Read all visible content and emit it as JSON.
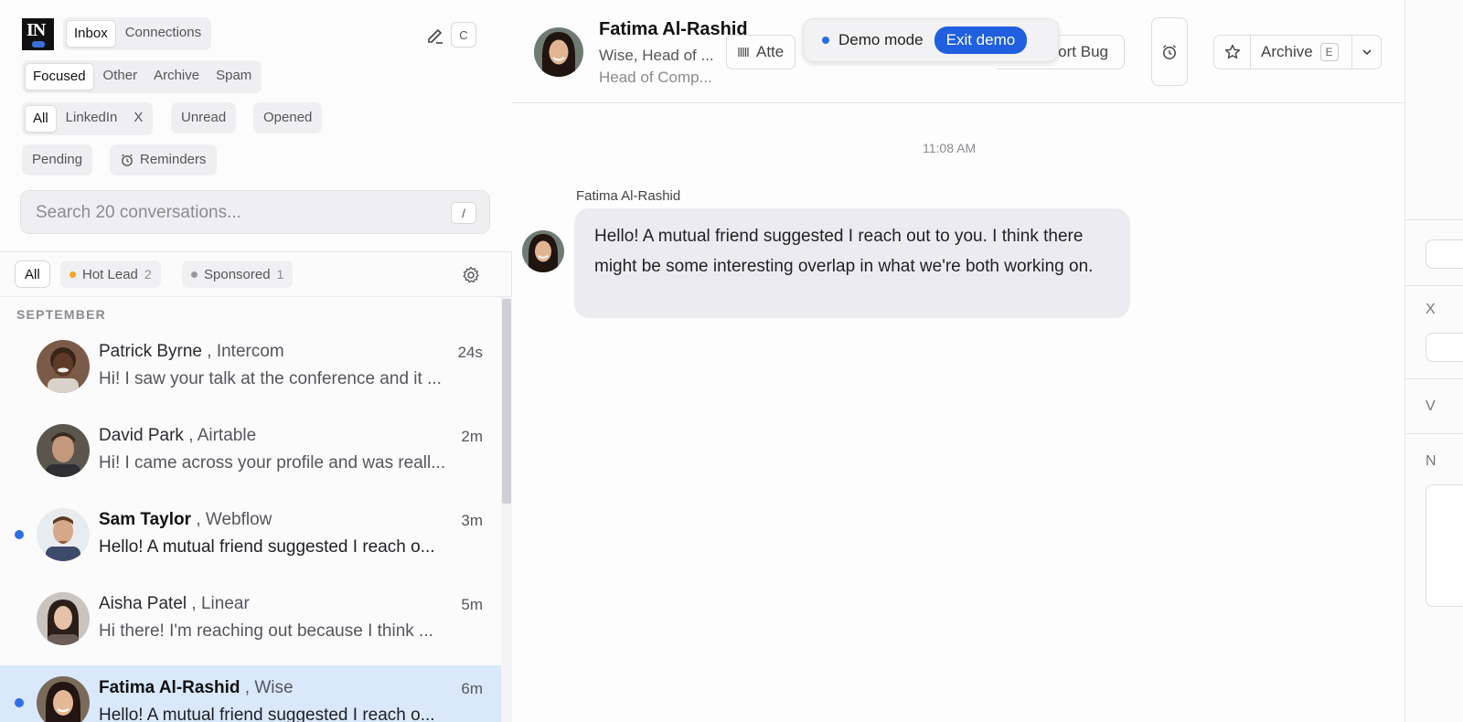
{
  "sidebar": {
    "logo_text": "IN",
    "top_tabs": [
      "Inbox",
      "Connections"
    ],
    "compose_key": "C",
    "folder_tabs": [
      "Focused",
      "Other",
      "Archive",
      "Spam"
    ],
    "channel_tabs": [
      "All",
      "LinkedIn",
      "X"
    ],
    "filter_unread": "Unread",
    "filter_opened": "Opened",
    "filter_pending": "Pending",
    "filter_reminders": "Reminders",
    "search_placeholder": "Search 20 conversations...",
    "search_shortcut": "/",
    "tags": {
      "all": "All",
      "hot_lead": "Hot Lead",
      "hot_lead_count": "2",
      "sponsored": "Sponsored",
      "sponsored_count": "1"
    },
    "tag_colors": {
      "hot_lead": "#f5a524",
      "sponsored": "#9a9aa2"
    },
    "section_label": "SEPTEMBER",
    "conversations": [
      {
        "name": "Patrick Byrne",
        "company": ", Intercom",
        "time": "24s",
        "preview": "Hi! I saw your talk at the conference and it ...",
        "unread": false,
        "selected": false
      },
      {
        "name": "David Park",
        "company": ", Airtable",
        "time": "2m",
        "preview": "Hi! I came across your profile and was reall...",
        "unread": false,
        "selected": false
      },
      {
        "name": "Sam Taylor",
        "company": ", Webflow",
        "time": "3m",
        "preview": "Hello! A mutual friend suggested I reach o...",
        "unread": true,
        "selected": false
      },
      {
        "name": "Aisha Patel",
        "company": ", Linear",
        "time": "5m",
        "preview": "Hi there! I'm reaching out because I think ...",
        "unread": false,
        "selected": false
      },
      {
        "name": "Fatima Al-Rashid",
        "company": ", Wise",
        "time": "6m",
        "preview": "Hello! A mutual friend suggested I reach o...",
        "unread": true,
        "selected": true
      }
    ]
  },
  "header": {
    "name": "Fatima Al-Rashid",
    "subtitle1": "Wise, Head of ...",
    "subtitle2": "Head of Comp...",
    "attach_label": "Atte",
    "report_bug": "Report Bug",
    "archive_label": "Archive",
    "archive_key": "E"
  },
  "demo_banner": {
    "label": "Demo mode",
    "exit": "Exit demo"
  },
  "thread": {
    "timestamp": "11:08 AM",
    "sender": "Fatima Al-Rashid",
    "message": "Hello! A mutual friend suggested I reach out to you. I think there might be some interesting overlap in what we're both working on."
  },
  "right_panel": {
    "label_x": "X",
    "label_v": "V",
    "label_n": "N"
  },
  "colors": {
    "accent": "#1f5fe0",
    "unread_dot": "#2b6fe5",
    "selected_row": "#d9e8fb"
  }
}
